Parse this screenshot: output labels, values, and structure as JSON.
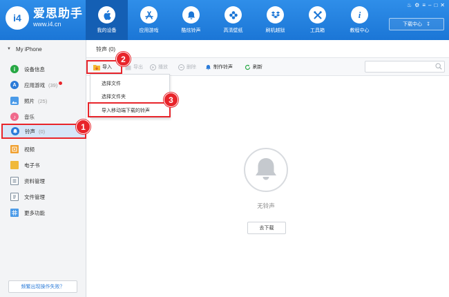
{
  "header": {
    "logo_mark": "i4",
    "app_name": "爱思助手",
    "url": "www.i4.cn",
    "download_center": "下载中心",
    "nav": [
      {
        "label": "我的设备",
        "icon": "apple-icon",
        "active": true
      },
      {
        "label": "应用游戏",
        "icon": "app-store-icon",
        "active": false
      },
      {
        "label": "酷炫铃声",
        "icon": "bell-icon",
        "active": false
      },
      {
        "label": "高清壁纸",
        "icon": "flower-icon",
        "active": false
      },
      {
        "label": "刷机越狱",
        "icon": "dropbox-icon",
        "active": false
      },
      {
        "label": "工具箱",
        "icon": "tools-icon",
        "active": false
      },
      {
        "label": "教程中心",
        "icon": "info-icon",
        "active": false
      }
    ]
  },
  "sidebar": {
    "device": "My iPhone",
    "items": [
      {
        "label": "设备信息",
        "count": "",
        "icon": "info-icon",
        "color": "#27a844"
      },
      {
        "label": "应用游戏",
        "count": "(39)",
        "icon": "app-icon",
        "color": "#2b7bd8"
      },
      {
        "label": "照片",
        "count": "(25)",
        "icon": "photo-icon",
        "color": "#4a9ae8"
      },
      {
        "label": "音乐",
        "count": "",
        "icon": "music-icon",
        "color": "#f06a8c"
      },
      {
        "label": "铃声",
        "count": "(0)",
        "icon": "bell-icon",
        "color": "#2b7bd8"
      },
      {
        "label": "视频",
        "count": "",
        "icon": "video-icon",
        "color": "#f0a030"
      },
      {
        "label": "电子书",
        "count": "",
        "icon": "book-icon",
        "color": "#f0b93a"
      },
      {
        "label": "资料管理",
        "count": "",
        "icon": "contacts-icon",
        "color": "#7a8a9a"
      },
      {
        "label": "文件管理",
        "count": "",
        "icon": "file-icon",
        "color": "#7a8a9a"
      },
      {
        "label": "更多功能",
        "count": "",
        "icon": "grid-icon",
        "color": "#4a9ae8"
      }
    ],
    "footer": "频繁出现操作失败？"
  },
  "content": {
    "tab": "铃声 (0)",
    "toolbar": {
      "import": "导入",
      "export": "导出",
      "play": "播放",
      "delete": "删除",
      "make": "制作铃声",
      "refresh": "刷新"
    },
    "dropdown": [
      "选择文件",
      "选择文件夹",
      "导入移动端下载的铃声"
    ],
    "empty_text": "无铃声",
    "go_download": "去下载"
  },
  "markers": [
    "1",
    "2",
    "3"
  ],
  "colors": {
    "header": "#1b76d6",
    "active_nav": "#145fb4",
    "highlight": "#e8242a",
    "sidebar_bg": "#f3f4f6"
  }
}
